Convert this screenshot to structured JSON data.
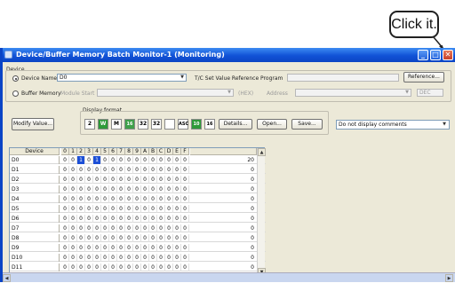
{
  "callout": {
    "text": "Click it."
  },
  "window": {
    "title": "Device/Buffer Memory Batch Monitor-1 (Monitoring)",
    "buttons": {
      "minimize": "_",
      "maximize": "□",
      "close": "✕"
    }
  },
  "device_section": {
    "label": "Device",
    "device_name_label": "Device Name",
    "device_name_value": "D0",
    "tc_label": "T/C Set Value Reference Program",
    "reference_button": "Reference...",
    "buffer_memory_label": "Buffer Memory",
    "module_start_label": "Module Start",
    "hex_label": "(HEX)",
    "address_label": "Address",
    "dec_value": "DEC"
  },
  "toolbar": {
    "display_format_label": "Display format",
    "modify_button": "Modify Value...",
    "fmt_2": "2",
    "fmt_w": "W",
    "fmt_m": "M",
    "fmt_16s": "16",
    "fmt_32a": "32",
    "fmt_32b": "32",
    "fmt_asc": "ASC",
    "fmt_10": "10",
    "fmt_16": "16",
    "details_button": "Details...",
    "open_button": "Open...",
    "save_button": "Save...",
    "comments_select": "Do not display comments"
  },
  "grid": {
    "device_header": "Device",
    "bit_headers": [
      "0",
      "1",
      "2",
      "3",
      "4",
      "5",
      "6",
      "7",
      "8",
      "9",
      "A",
      "B",
      "C",
      "D",
      "E",
      "F"
    ],
    "rows": [
      {
        "device": "D0",
        "bits": [
          "0",
          "0",
          "1",
          "0",
          "1",
          "0",
          "0",
          "0",
          "0",
          "0",
          "0",
          "0",
          "0",
          "0",
          "0",
          "0"
        ],
        "value": "20"
      },
      {
        "device": "D1",
        "bits": [
          "0",
          "0",
          "0",
          "0",
          "0",
          "0",
          "0",
          "0",
          "0",
          "0",
          "0",
          "0",
          "0",
          "0",
          "0",
          "0"
        ],
        "value": "0"
      },
      {
        "device": "D2",
        "bits": [
          "0",
          "0",
          "0",
          "0",
          "0",
          "0",
          "0",
          "0",
          "0",
          "0",
          "0",
          "0",
          "0",
          "0",
          "0",
          "0"
        ],
        "value": "0"
      },
      {
        "device": "D3",
        "bits": [
          "0",
          "0",
          "0",
          "0",
          "0",
          "0",
          "0",
          "0",
          "0",
          "0",
          "0",
          "0",
          "0",
          "0",
          "0",
          "0"
        ],
        "value": "0"
      },
      {
        "device": "D4",
        "bits": [
          "0",
          "0",
          "0",
          "0",
          "0",
          "0",
          "0",
          "0",
          "0",
          "0",
          "0",
          "0",
          "0",
          "0",
          "0",
          "0"
        ],
        "value": "0"
      },
      {
        "device": "D5",
        "bits": [
          "0",
          "0",
          "0",
          "0",
          "0",
          "0",
          "0",
          "0",
          "0",
          "0",
          "0",
          "0",
          "0",
          "0",
          "0",
          "0"
        ],
        "value": "0"
      },
      {
        "device": "D6",
        "bits": [
          "0",
          "0",
          "0",
          "0",
          "0",
          "0",
          "0",
          "0",
          "0",
          "0",
          "0",
          "0",
          "0",
          "0",
          "0",
          "0"
        ],
        "value": "0"
      },
      {
        "device": "D7",
        "bits": [
          "0",
          "0",
          "0",
          "0",
          "0",
          "0",
          "0",
          "0",
          "0",
          "0",
          "0",
          "0",
          "0",
          "0",
          "0",
          "0"
        ],
        "value": "0"
      },
      {
        "device": "D8",
        "bits": [
          "0",
          "0",
          "0",
          "0",
          "0",
          "0",
          "0",
          "0",
          "0",
          "0",
          "0",
          "0",
          "0",
          "0",
          "0",
          "0"
        ],
        "value": "0"
      },
      {
        "device": "D9",
        "bits": [
          "0",
          "0",
          "0",
          "0",
          "0",
          "0",
          "0",
          "0",
          "0",
          "0",
          "0",
          "0",
          "0",
          "0",
          "0",
          "0"
        ],
        "value": "0"
      },
      {
        "device": "D10",
        "bits": [
          "0",
          "0",
          "0",
          "0",
          "0",
          "0",
          "0",
          "0",
          "0",
          "0",
          "0",
          "0",
          "0",
          "0",
          "0",
          "0"
        ],
        "value": "0"
      },
      {
        "device": "D11",
        "bits": [
          "0",
          "0",
          "0",
          "0",
          "0",
          "0",
          "0",
          "0",
          "0",
          "0",
          "0",
          "0",
          "0",
          "0",
          "0",
          "0"
        ],
        "value": "0"
      }
    ]
  },
  "colors": {
    "titlebar": "#1152d6",
    "bit_on": "#1c4fd6",
    "close_highlight": "#e03030"
  }
}
